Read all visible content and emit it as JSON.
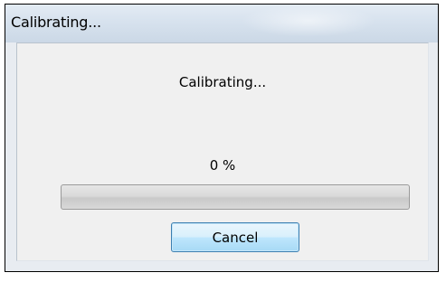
{
  "window": {
    "title": "Calibrating..."
  },
  "dialog": {
    "message": "Calibrating...",
    "progress_text": "0 %",
    "progress_fraction": 0,
    "cancel_label": "Cancel"
  }
}
